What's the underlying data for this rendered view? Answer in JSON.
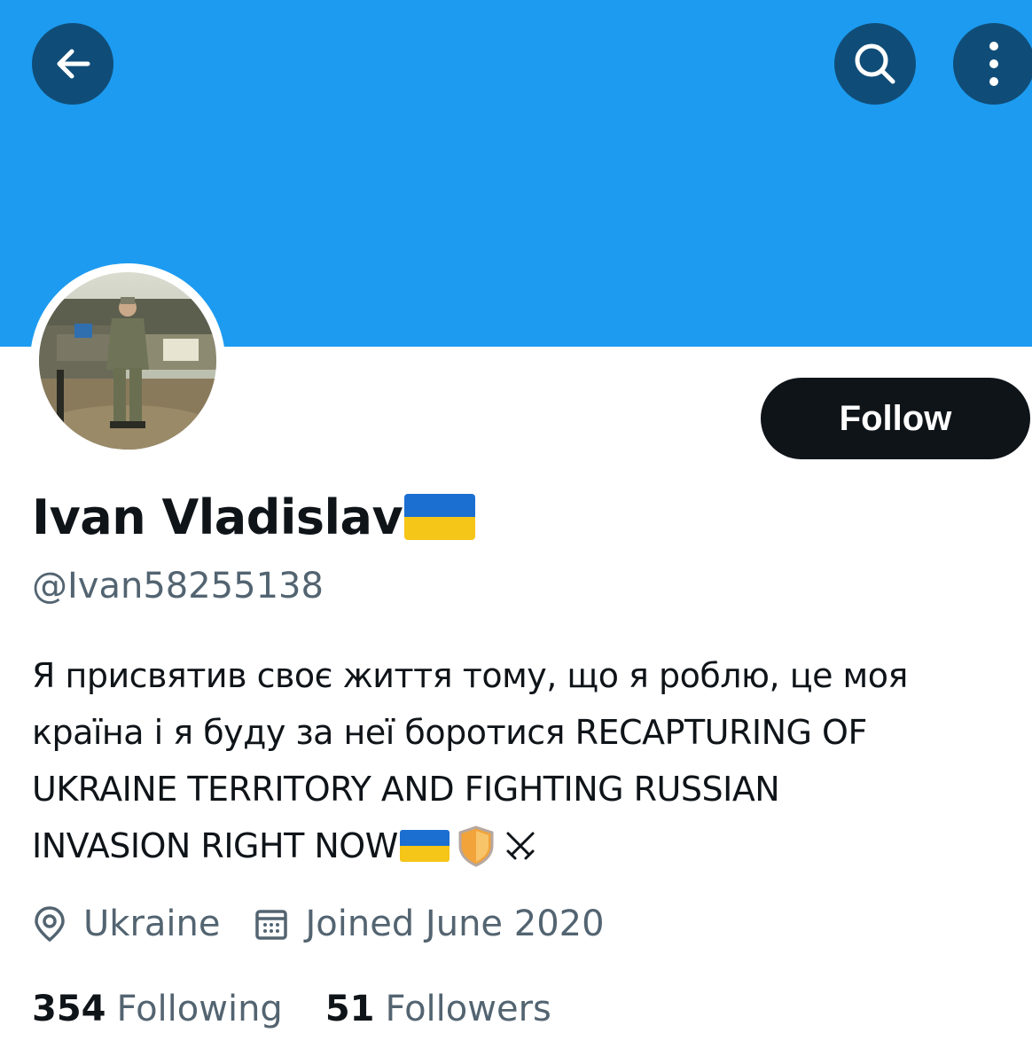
{
  "profile": {
    "display_name": "Ivan Vladislav",
    "name_emoji": "ukraine-flag",
    "handle": "@Ivan58255138",
    "bio_lines": [
      "Я присвятив своє життя тому, що я роблю, це моя",
      "країна і я буду за неї боротися RECAPTURING OF",
      "UKRAINE TERRITORY AND FIGHTING RUSSIAN",
      "INVASION RIGHT NOW"
    ],
    "bio_trailing_emojis": [
      "ukraine-flag",
      "shield",
      "crossed-swords"
    ],
    "location": "Ukraine",
    "joined": "Joined June 2020",
    "following_count": "354",
    "following_label": "Following",
    "followers_count": "51",
    "followers_label": "Followers"
  },
  "actions": {
    "follow_label": "Follow",
    "back_icon": "arrow-left-icon",
    "search_icon": "search-icon",
    "more_icon": "more-vertical-icon"
  },
  "colors": {
    "banner": "#1d9bf0",
    "icon_button_bg": "#0f4d78",
    "text_primary": "#0f1419",
    "text_secondary": "#536471",
    "follow_bg": "#0f1419"
  }
}
